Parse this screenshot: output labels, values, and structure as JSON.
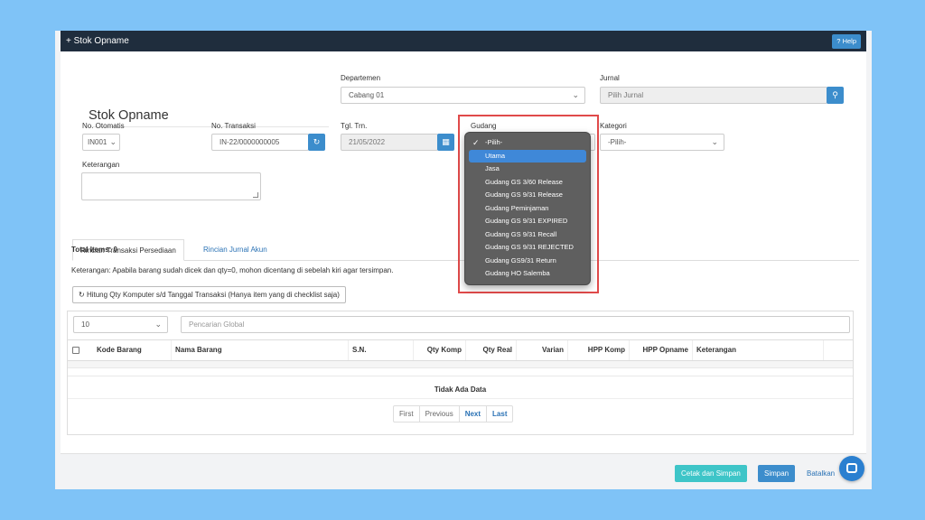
{
  "header": {
    "title": "Stok Opname",
    "help_label": "Help"
  },
  "form": {
    "page_title": "Stok Opname",
    "departemen": {
      "label": "Departemen",
      "value": "Cabang 01"
    },
    "jurnal": {
      "label": "Jurnal",
      "placeholder": "Pilih Jurnal"
    },
    "no_otomatis": {
      "label": "No. Otomatis",
      "value": "IN001"
    },
    "no_transaksi": {
      "label": "No. Transaksi",
      "value": "IN-22/0000000005"
    },
    "tgl_trn": {
      "label": "Tgl. Trn.",
      "value": "21/05/2022"
    },
    "gudang": {
      "label": "Gudang"
    },
    "kategori": {
      "label": "Kategori",
      "value": "-Pilih-"
    },
    "keterangan": {
      "label": "Keterangan"
    }
  },
  "tabs": [
    {
      "label": "Rincian Transaksi Persediaan"
    },
    {
      "label": "Rincian Jurnal Akun"
    }
  ],
  "total_items": "Total Items: 0",
  "note": "Keterangan: Apabila barang sudah dicek dan qty=0, mohon dicentang di sebelah kiri agar tersimpan.",
  "calc_button": "Hitung Qty Komputer s/d Tanggal Transaksi (Hanya item yang di checklist saja)",
  "table": {
    "page_size": "10",
    "search_placeholder": "Pencarian Global",
    "columns": [
      "Kode Barang",
      "Nama Barang",
      "S.N.",
      "Qty Komp",
      "Qty Real",
      "Varian",
      "HPP Komp",
      "HPP Opname",
      "Keterangan"
    ],
    "empty_text": "Tidak Ada Data",
    "pager": [
      "First",
      "Previous",
      "Next",
      "Last"
    ]
  },
  "footer": {
    "print_save": "Cetak dan Simpan",
    "save": "Simpan",
    "cancel": "Batalkan"
  },
  "gudang_dropdown": {
    "selected": "-Pilih-",
    "highlighted": "Utama",
    "options": [
      "-Pilih-",
      "Utama",
      "Jasa",
      "Gudang GS 3/60 Release",
      "Gudang GS 9/31 Release",
      "Gudang Peminjaman",
      "Gudang GS 9/31 EXPIRED",
      "Gudang GS 9/31 Recall",
      "Gudang GS 9/31 REJECTED",
      "Gudang GS9/31 Return",
      "Gudang HO Salemba"
    ]
  },
  "colors": {
    "accent": "#3c8dcc",
    "titlebar": "#1f2d3d",
    "teal": "#3ec5c8",
    "highlight_border": "#e04a4a"
  }
}
